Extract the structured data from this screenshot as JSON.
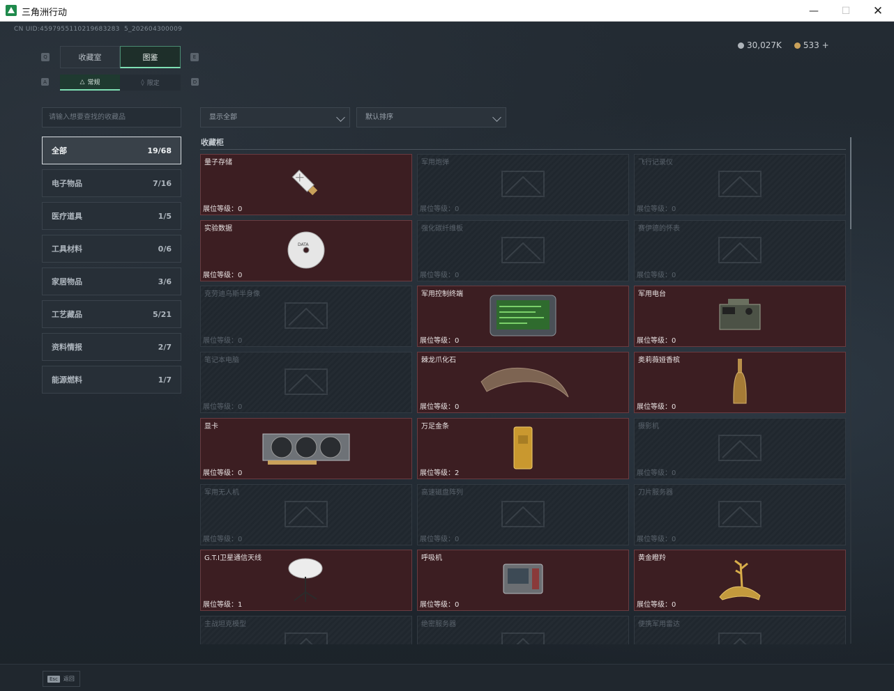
{
  "window": {
    "title": "三角洲行动"
  },
  "uid": "CN UID:4597955110219683283  5_202604300009",
  "currency": {
    "silver": "30,027K",
    "gold": "533",
    "add": "+"
  },
  "tabs": {
    "collection": "收藏室",
    "catalog": "图鉴"
  },
  "subtabs": {
    "normal": "常规",
    "limited": "限定"
  },
  "search": {
    "placeholder": "请输入想要查找的收藏品"
  },
  "filters": {
    "show": "显示全部",
    "sort": "默认排序"
  },
  "categories": [
    {
      "label": "全部",
      "count": "19/68"
    },
    {
      "label": "电子物品",
      "count": "7/16"
    },
    {
      "label": "医疗道具",
      "count": "1/5"
    },
    {
      "label": "工具材料",
      "count": "0/6"
    },
    {
      "label": "家居物品",
      "count": "3/6"
    },
    {
      "label": "工艺藏品",
      "count": "5/21"
    },
    {
      "label": "资料情报",
      "count": "2/7"
    },
    {
      "label": "能源燃料",
      "count": "1/7"
    }
  ],
  "section": {
    "title": "收藏柜"
  },
  "level_prefix": "展位等级：",
  "items": [
    {
      "name": "量子存储",
      "level": "展位等级：0",
      "owned": true,
      "icon": "usb-drive-icon"
    },
    {
      "name": "军用炮弹",
      "level": "展位等级：0",
      "owned": false,
      "icon": "shell-icon"
    },
    {
      "name": "飞行记录仪",
      "level": "展位等级：0",
      "owned": false,
      "icon": "flight-recorder-icon"
    },
    {
      "name": "实验数据",
      "level": "展位等级：0",
      "owned": true,
      "icon": "disc-icon"
    },
    {
      "name": "强化碳纤维板",
      "level": "展位等级：0",
      "owned": false,
      "icon": "carbon-plate-icon"
    },
    {
      "name": "赛伊德的怀表",
      "level": "展位等级：0",
      "owned": false,
      "icon": "pocket-watch-icon"
    },
    {
      "name": "克劳迪乌斯半身像",
      "level": "展位等级：0",
      "owned": false,
      "icon": "bust-icon"
    },
    {
      "name": "军用控制终端",
      "level": "展位等级：0",
      "owned": true,
      "icon": "control-terminal-icon"
    },
    {
      "name": "军用电台",
      "level": "展位等级：0",
      "owned": true,
      "icon": "radio-icon"
    },
    {
      "name": "笔记本电脑",
      "level": "展位等级：0",
      "owned": false,
      "icon": "laptop-icon"
    },
    {
      "name": "棘龙爪化石",
      "level": "展位等级：0",
      "owned": true,
      "icon": "claw-fossil-icon"
    },
    {
      "name": "奥莉薇娅香槟",
      "level": "展位等级：0",
      "owned": true,
      "icon": "champagne-icon"
    },
    {
      "name": "显卡",
      "level": "展位等级：0",
      "owned": true,
      "icon": "graphics-card-icon"
    },
    {
      "name": "万足金条",
      "level": "展位等级：2",
      "owned": true,
      "icon": "gold-bar-icon"
    },
    {
      "name": "摄影机",
      "level": "展位等级：0",
      "owned": false,
      "icon": "camera-icon"
    },
    {
      "name": "军用无人机",
      "level": "展位等级：0",
      "owned": false,
      "icon": "drone-icon"
    },
    {
      "name": "高速磁盘阵列",
      "level": "展位等级：0",
      "owned": false,
      "icon": "disk-array-icon"
    },
    {
      "name": "刀片服务器",
      "level": "展位等级：0",
      "owned": false,
      "icon": "blade-server-icon"
    },
    {
      "name": "G.T.I卫星通信天线",
      "level": "展位等级：1",
      "owned": true,
      "icon": "satellite-dish-icon"
    },
    {
      "name": "呼吸机",
      "level": "展位等级：0",
      "owned": true,
      "icon": "ventilator-icon"
    },
    {
      "name": "黄金瞪羚",
      "level": "展位等级：0",
      "owned": true,
      "icon": "gold-gazelle-icon"
    },
    {
      "name": "主战坦克模型",
      "level": "",
      "owned": false,
      "icon": "tank-model-icon"
    },
    {
      "name": "绝密服务器",
      "level": "",
      "owned": false,
      "icon": "secret-server-icon"
    },
    {
      "name": "便携军用雷达",
      "level": "",
      "owned": false,
      "icon": "radar-icon"
    }
  ],
  "footer": {
    "esc_key": "Esc",
    "back": "返回"
  },
  "colors": {
    "accent": "#7fe0b4",
    "owned_card": "#3c1e22",
    "locked_card": "#20272e"
  }
}
